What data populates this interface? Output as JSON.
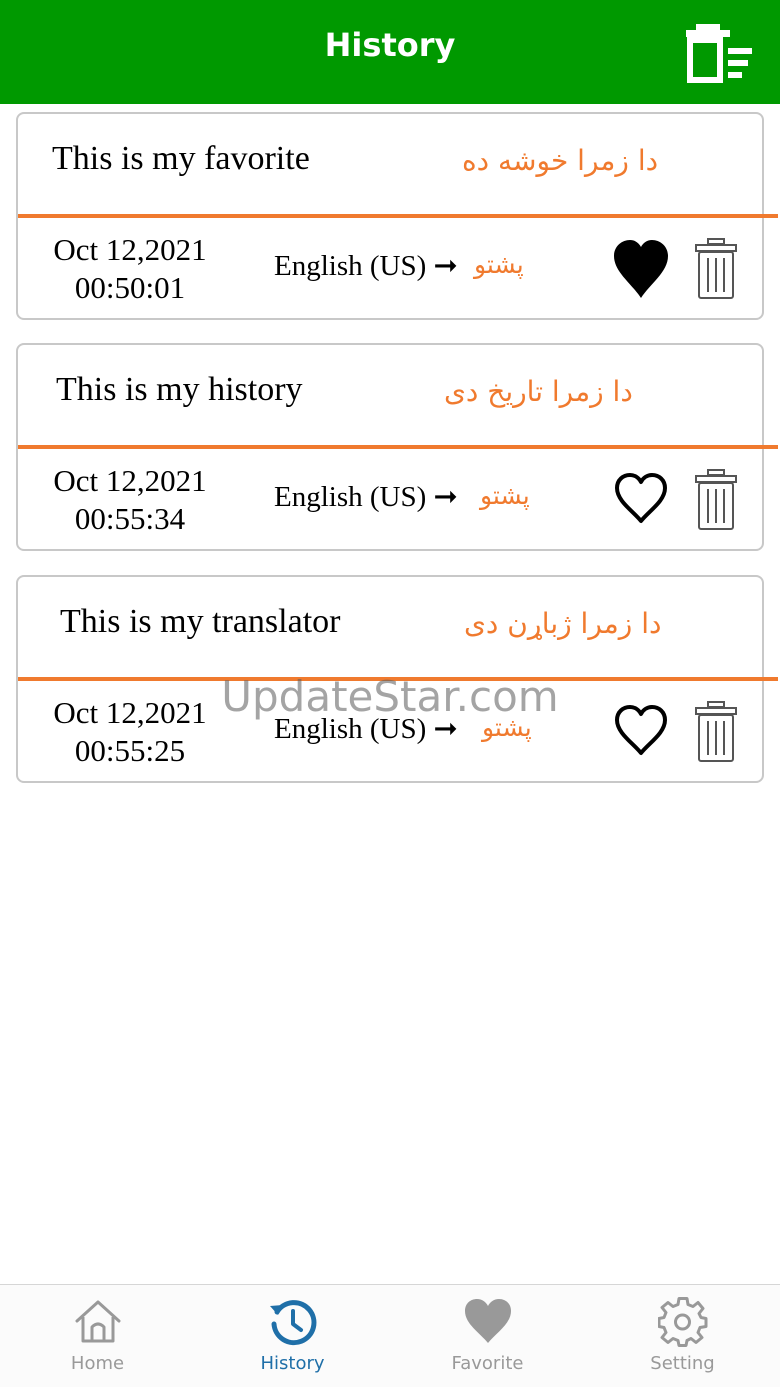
{
  "header": {
    "title": "History"
  },
  "records": [
    {
      "source_text": "This is my favorite",
      "translated_text": "دا زمرا خوشە دە",
      "date": "Oct 12,2021",
      "time": "00:50:01",
      "source_lang": "English (US) ➞",
      "target_lang": "پشتو",
      "favorited": true
    },
    {
      "source_text": "This is my history",
      "translated_text": "دا زمرا تاریخ دی",
      "date": "Oct 12,2021",
      "time": "00:55:34",
      "source_lang": "English (US) ➞",
      "target_lang": "پشتو",
      "favorited": false
    },
    {
      "source_text": "This is my translator",
      "translated_text": "دا زمرا ژباړن دی",
      "date": "Oct 12,2021",
      "time": "00:55:25",
      "source_lang": "English (US) ➞",
      "target_lang": "پشتو",
      "favorited": false
    }
  ],
  "watermark": "UpdateStar.com",
  "tabs": [
    {
      "label": "Home",
      "icon": "home-icon",
      "active": false
    },
    {
      "label": "History",
      "icon": "history-icon",
      "active": true
    },
    {
      "label": "Favorite",
      "icon": "heart-icon",
      "active": false
    },
    {
      "label": "Setting",
      "icon": "gear-icon",
      "active": false
    }
  ],
  "colors": {
    "header": "#009900",
    "accent": "#f07a2e",
    "tab_active": "#1f6fa8",
    "tab_inactive": "#999999"
  }
}
